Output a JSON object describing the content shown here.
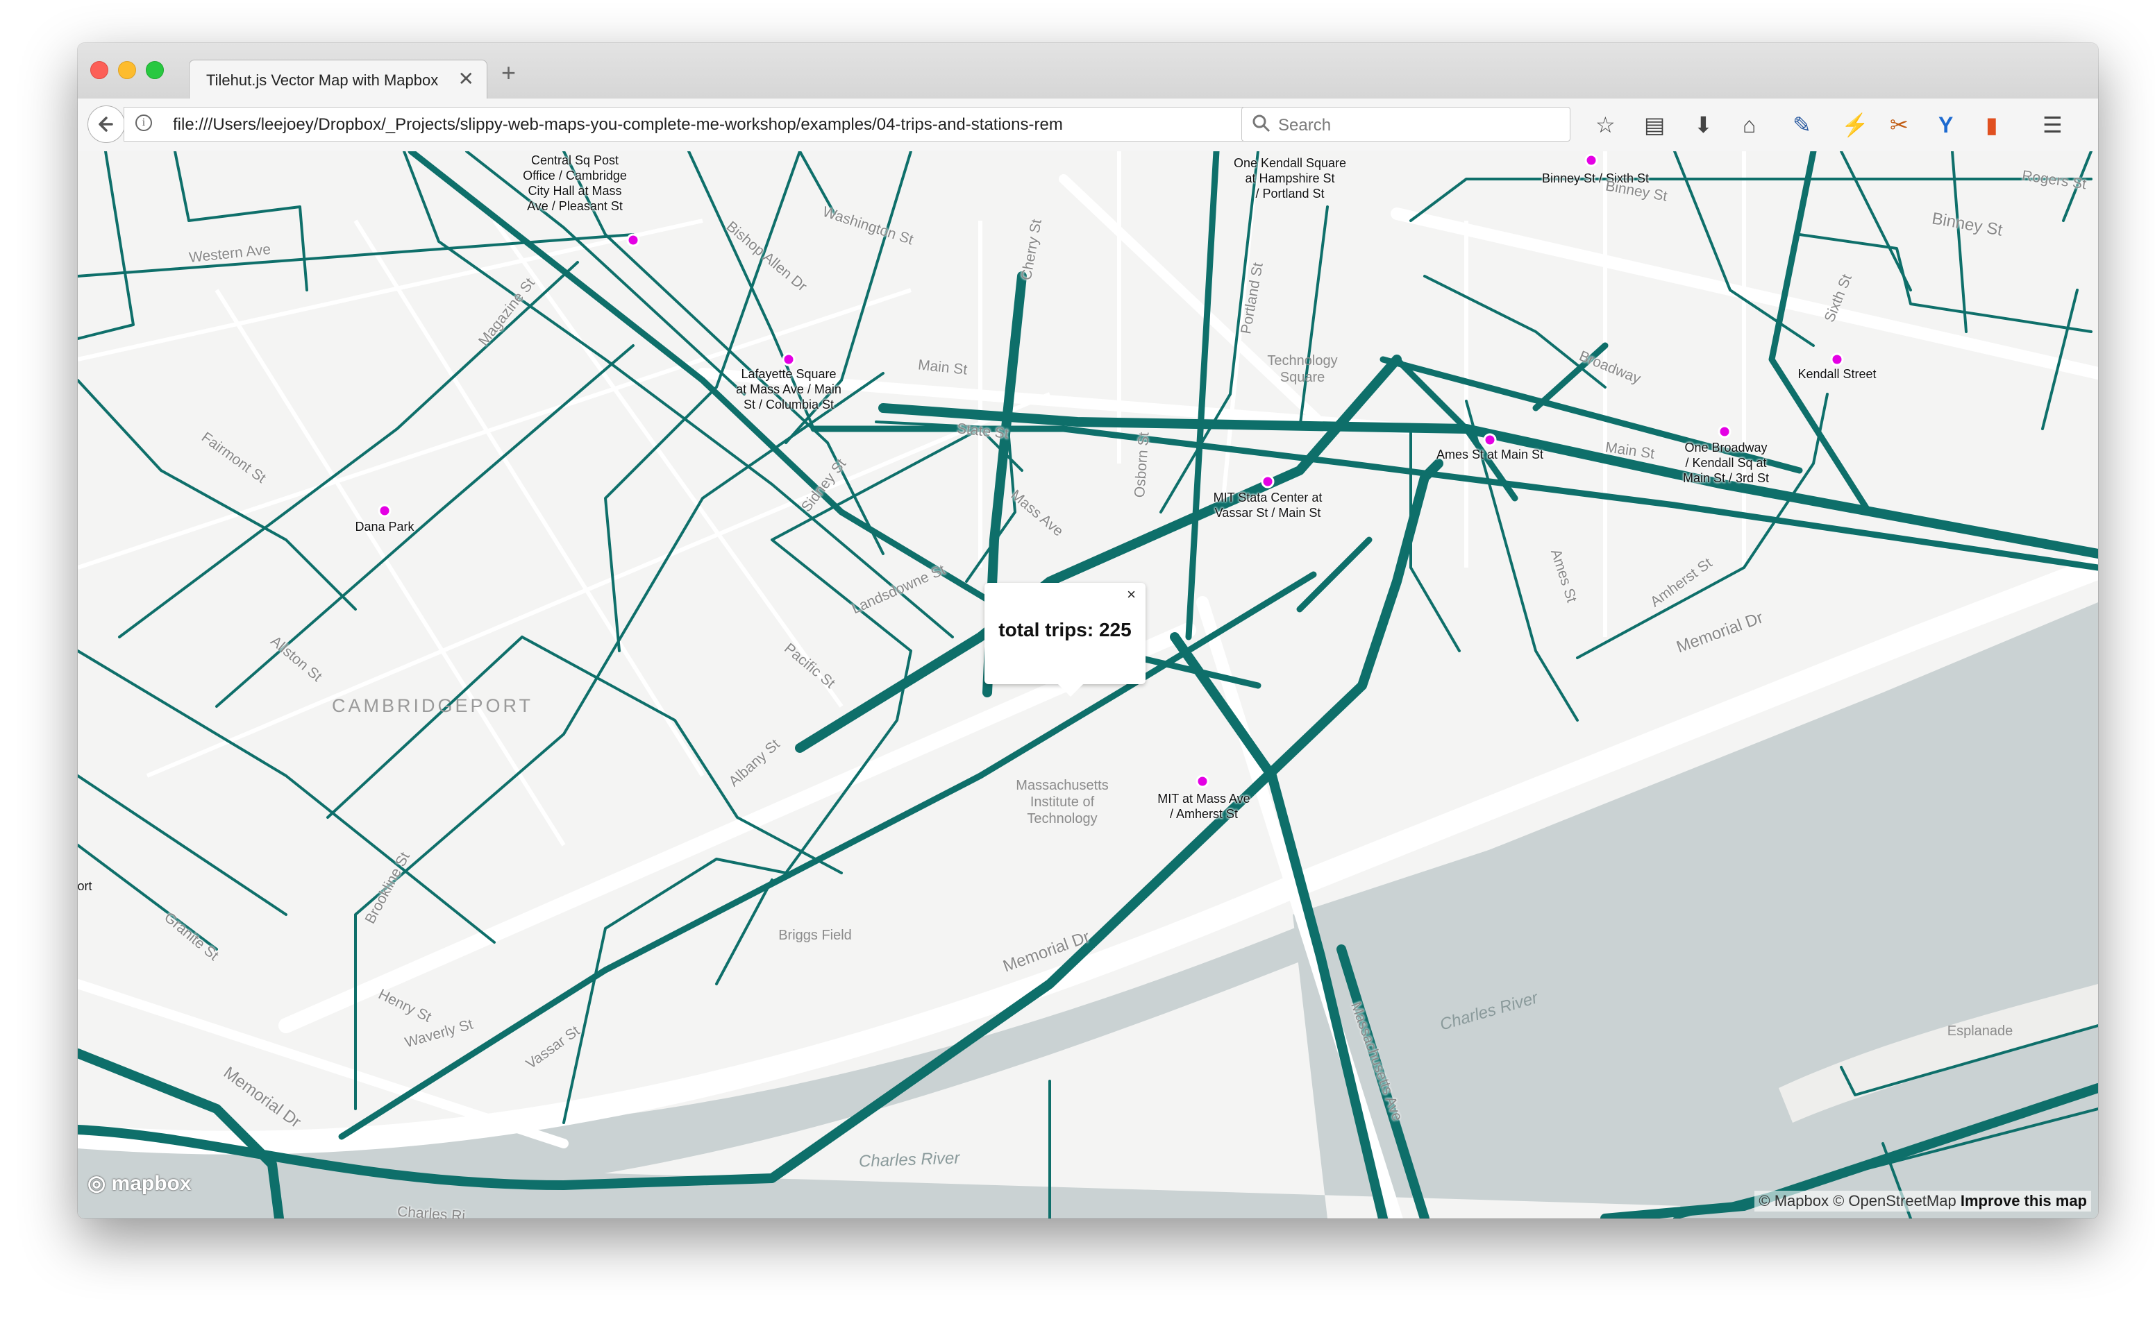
{
  "browser": {
    "tab_title": "Tilehut.js Vector Map with Mapbox",
    "tab_close": "✕",
    "new_tab": "+",
    "url": "file:///Users/leejoey/Dropbox/_Projects/slippy-web-maps-you-complete-me-workshop/examples/04-trips-and-stations-rem",
    "search_placeholder": "Search",
    "toolbar_icons": [
      "bookmark-star-icon",
      "reading-list-icon",
      "download-icon",
      "home-icon",
      "eyedropper-icon",
      "extension-icon",
      "screenshot-icon",
      "extension-y-icon",
      "extension-battery-icon",
      "menu-icon"
    ]
  },
  "map": {
    "popup": {
      "text": "total trips: 225",
      "close": "×"
    },
    "stations": [
      {
        "name": "Central Sq Post\nOffice / Cambridge\nCity Hall at Mass\nAve / Pleasant St",
        "dot": false
      },
      {
        "name": "One Kendall Square\nat Hampshire St\n/ Portland St",
        "dot": false
      },
      {
        "name": "Binney St / Sixth St",
        "dot": true
      },
      {
        "name": "Lafayette Square\nat Mass Ave / Main\nSt / Columbia St",
        "dot": true
      },
      {
        "name": "Kendall Street",
        "dot": true
      },
      {
        "name": "Ames St at Main St",
        "dot": true
      },
      {
        "name": "One Broadway\n/ Kendall Sq at\nMain St / 3rd St",
        "dot": true
      },
      {
        "name": "MIT Stata Center at\nVassar St / Main St",
        "dot": true
      },
      {
        "name": "Dana Park",
        "dot": true
      },
      {
        "name": "MIT at Mass Ave\n/ Amherst St",
        "dot": true
      },
      {
        "name": "ort",
        "dot": false
      }
    ],
    "streets": [
      "Western Ave",
      "Washington St",
      "Bishop Allen Dr",
      "Cherry St",
      "Portland St",
      "Binney St",
      "Rogers St",
      "Binney St",
      "Magazine St",
      "Main St",
      "State St",
      "Osborn St",
      "Broadway",
      "Sixth St",
      "Fairmont St",
      "Sidney St",
      "Landsdowne St",
      "Mass Ave",
      "Ames St",
      "Amherst St",
      "Allston St",
      "Pacific St",
      "Albany St",
      "Brookline St",
      "Memorial Dr",
      "Granite St",
      "Henry St",
      "Waverly St",
      "Vassar St",
      "Memorial Dr",
      "Memorial Dr",
      "Massachusetts Ave",
      "Main St",
      "Charles Ri"
    ],
    "water": [
      "Charles River",
      "Charles River"
    ],
    "areas": [
      "CAMBRIDGEPORT"
    ],
    "pois": [
      "Technology\nSquare",
      "Massachusetts\nInstitute of\nTechnology",
      "Briggs Field",
      "Esplanade"
    ],
    "logo": "mapbox",
    "attribution": {
      "text": "© Mapbox © OpenStreetMap",
      "link": "Improve this map"
    },
    "colors": {
      "route": "#0e6f6a",
      "station_dot": "#e400e4",
      "water": "#cad2d3",
      "land": "#f4f4f3",
      "road": "#ffffff"
    }
  }
}
